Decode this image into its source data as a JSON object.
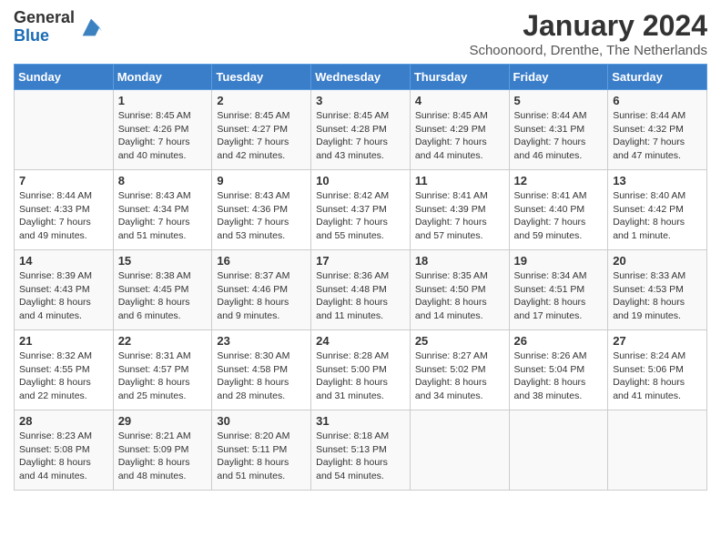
{
  "logo": {
    "general": "General",
    "blue": "Blue"
  },
  "title": "January 2024",
  "location": "Schoonoord, Drenthe, The Netherlands",
  "headers": [
    "Sunday",
    "Monday",
    "Tuesday",
    "Wednesday",
    "Thursday",
    "Friday",
    "Saturday"
  ],
  "weeks": [
    [
      {
        "day": "",
        "sunrise": "",
        "sunset": "",
        "daylight": ""
      },
      {
        "day": "1",
        "sunrise": "Sunrise: 8:45 AM",
        "sunset": "Sunset: 4:26 PM",
        "daylight": "Daylight: 7 hours and 40 minutes."
      },
      {
        "day": "2",
        "sunrise": "Sunrise: 8:45 AM",
        "sunset": "Sunset: 4:27 PM",
        "daylight": "Daylight: 7 hours and 42 minutes."
      },
      {
        "day": "3",
        "sunrise": "Sunrise: 8:45 AM",
        "sunset": "Sunset: 4:28 PM",
        "daylight": "Daylight: 7 hours and 43 minutes."
      },
      {
        "day": "4",
        "sunrise": "Sunrise: 8:45 AM",
        "sunset": "Sunset: 4:29 PM",
        "daylight": "Daylight: 7 hours and 44 minutes."
      },
      {
        "day": "5",
        "sunrise": "Sunrise: 8:44 AM",
        "sunset": "Sunset: 4:31 PM",
        "daylight": "Daylight: 7 hours and 46 minutes."
      },
      {
        "day": "6",
        "sunrise": "Sunrise: 8:44 AM",
        "sunset": "Sunset: 4:32 PM",
        "daylight": "Daylight: 7 hours and 47 minutes."
      }
    ],
    [
      {
        "day": "7",
        "sunrise": "Sunrise: 8:44 AM",
        "sunset": "Sunset: 4:33 PM",
        "daylight": "Daylight: 7 hours and 49 minutes."
      },
      {
        "day": "8",
        "sunrise": "Sunrise: 8:43 AM",
        "sunset": "Sunset: 4:34 PM",
        "daylight": "Daylight: 7 hours and 51 minutes."
      },
      {
        "day": "9",
        "sunrise": "Sunrise: 8:43 AM",
        "sunset": "Sunset: 4:36 PM",
        "daylight": "Daylight: 7 hours and 53 minutes."
      },
      {
        "day": "10",
        "sunrise": "Sunrise: 8:42 AM",
        "sunset": "Sunset: 4:37 PM",
        "daylight": "Daylight: 7 hours and 55 minutes."
      },
      {
        "day": "11",
        "sunrise": "Sunrise: 8:41 AM",
        "sunset": "Sunset: 4:39 PM",
        "daylight": "Daylight: 7 hours and 57 minutes."
      },
      {
        "day": "12",
        "sunrise": "Sunrise: 8:41 AM",
        "sunset": "Sunset: 4:40 PM",
        "daylight": "Daylight: 7 hours and 59 minutes."
      },
      {
        "day": "13",
        "sunrise": "Sunrise: 8:40 AM",
        "sunset": "Sunset: 4:42 PM",
        "daylight": "Daylight: 8 hours and 1 minute."
      }
    ],
    [
      {
        "day": "14",
        "sunrise": "Sunrise: 8:39 AM",
        "sunset": "Sunset: 4:43 PM",
        "daylight": "Daylight: 8 hours and 4 minutes."
      },
      {
        "day": "15",
        "sunrise": "Sunrise: 8:38 AM",
        "sunset": "Sunset: 4:45 PM",
        "daylight": "Daylight: 8 hours and 6 minutes."
      },
      {
        "day": "16",
        "sunrise": "Sunrise: 8:37 AM",
        "sunset": "Sunset: 4:46 PM",
        "daylight": "Daylight: 8 hours and 9 minutes."
      },
      {
        "day": "17",
        "sunrise": "Sunrise: 8:36 AM",
        "sunset": "Sunset: 4:48 PM",
        "daylight": "Daylight: 8 hours and 11 minutes."
      },
      {
        "day": "18",
        "sunrise": "Sunrise: 8:35 AM",
        "sunset": "Sunset: 4:50 PM",
        "daylight": "Daylight: 8 hours and 14 minutes."
      },
      {
        "day": "19",
        "sunrise": "Sunrise: 8:34 AM",
        "sunset": "Sunset: 4:51 PM",
        "daylight": "Daylight: 8 hours and 17 minutes."
      },
      {
        "day": "20",
        "sunrise": "Sunrise: 8:33 AM",
        "sunset": "Sunset: 4:53 PM",
        "daylight": "Daylight: 8 hours and 19 minutes."
      }
    ],
    [
      {
        "day": "21",
        "sunrise": "Sunrise: 8:32 AM",
        "sunset": "Sunset: 4:55 PM",
        "daylight": "Daylight: 8 hours and 22 minutes."
      },
      {
        "day": "22",
        "sunrise": "Sunrise: 8:31 AM",
        "sunset": "Sunset: 4:57 PM",
        "daylight": "Daylight: 8 hours and 25 minutes."
      },
      {
        "day": "23",
        "sunrise": "Sunrise: 8:30 AM",
        "sunset": "Sunset: 4:58 PM",
        "daylight": "Daylight: 8 hours and 28 minutes."
      },
      {
        "day": "24",
        "sunrise": "Sunrise: 8:28 AM",
        "sunset": "Sunset: 5:00 PM",
        "daylight": "Daylight: 8 hours and 31 minutes."
      },
      {
        "day": "25",
        "sunrise": "Sunrise: 8:27 AM",
        "sunset": "Sunset: 5:02 PM",
        "daylight": "Daylight: 8 hours and 34 minutes."
      },
      {
        "day": "26",
        "sunrise": "Sunrise: 8:26 AM",
        "sunset": "Sunset: 5:04 PM",
        "daylight": "Daylight: 8 hours and 38 minutes."
      },
      {
        "day": "27",
        "sunrise": "Sunrise: 8:24 AM",
        "sunset": "Sunset: 5:06 PM",
        "daylight": "Daylight: 8 hours and 41 minutes."
      }
    ],
    [
      {
        "day": "28",
        "sunrise": "Sunrise: 8:23 AM",
        "sunset": "Sunset: 5:08 PM",
        "daylight": "Daylight: 8 hours and 44 minutes."
      },
      {
        "day": "29",
        "sunrise": "Sunrise: 8:21 AM",
        "sunset": "Sunset: 5:09 PM",
        "daylight": "Daylight: 8 hours and 48 minutes."
      },
      {
        "day": "30",
        "sunrise": "Sunrise: 8:20 AM",
        "sunset": "Sunset: 5:11 PM",
        "daylight": "Daylight: 8 hours and 51 minutes."
      },
      {
        "day": "31",
        "sunrise": "Sunrise: 8:18 AM",
        "sunset": "Sunset: 5:13 PM",
        "daylight": "Daylight: 8 hours and 54 minutes."
      },
      {
        "day": "",
        "sunrise": "",
        "sunset": "",
        "daylight": ""
      },
      {
        "day": "",
        "sunrise": "",
        "sunset": "",
        "daylight": ""
      },
      {
        "day": "",
        "sunrise": "",
        "sunset": "",
        "daylight": ""
      }
    ]
  ]
}
